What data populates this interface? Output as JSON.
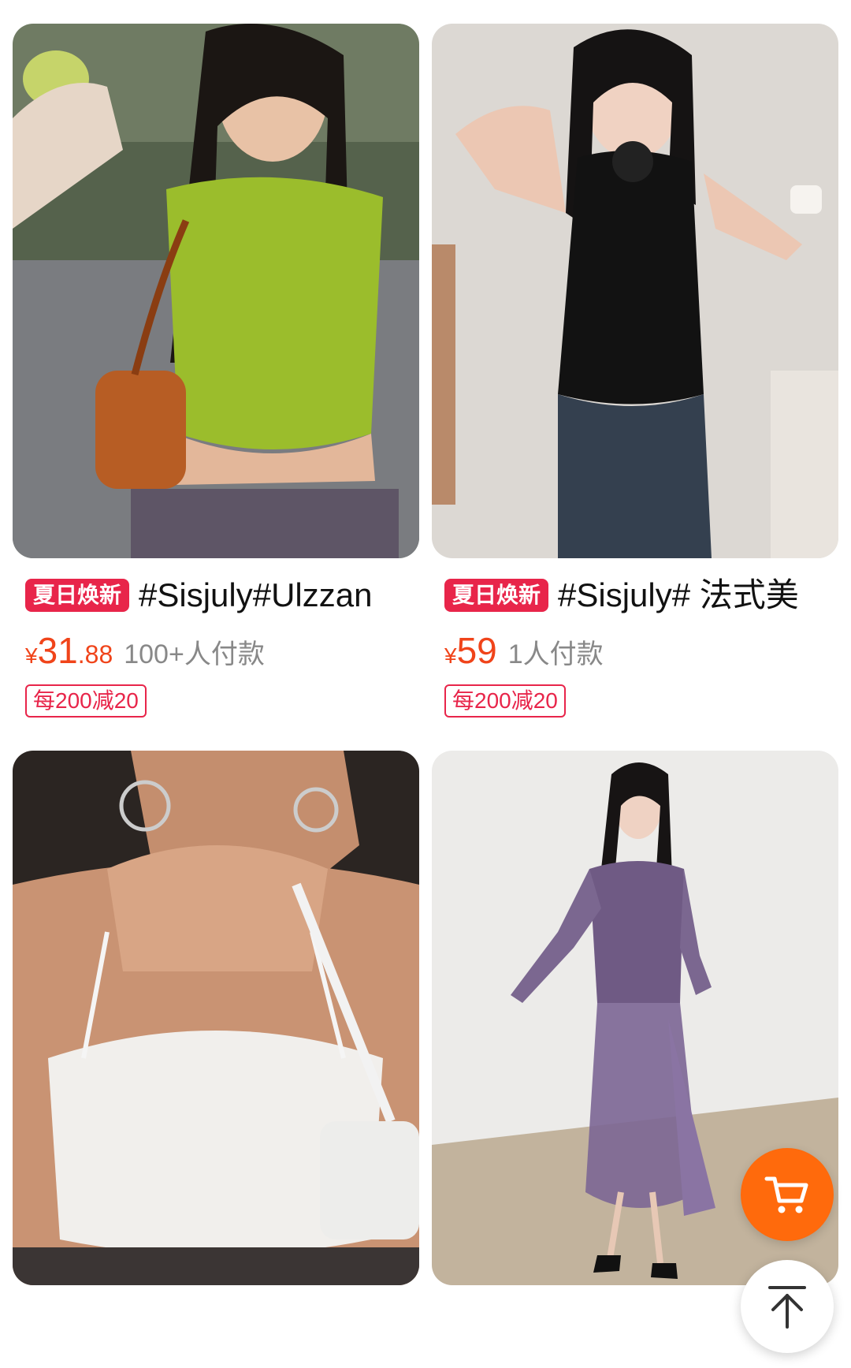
{
  "products": [
    {
      "tag": "夏日焕新",
      "title": "#Sisjuly#Ulzzan",
      "price_symbol": "¥",
      "price_int": "31",
      "price_dec": ".88",
      "sales": "100+人付款",
      "coupon": "每200减20",
      "image": "woman-green-crop-top-photo"
    },
    {
      "tag": "夏日焕新",
      "title": "#Sisjuly# 法式美",
      "price_symbol": "¥",
      "price_int": "59",
      "price_dec": "",
      "sales": "1人付款",
      "coupon": "每200减20",
      "image": "woman-black-halter-top-photo"
    },
    {
      "image": "woman-white-satin-camisole-photo"
    },
    {
      "image": "woman-purple-mesh-dress-photo"
    }
  ],
  "floating": {
    "cart_icon": "shopping-cart-icon",
    "top_icon": "arrow-up-to-top-icon"
  },
  "colors": {
    "tag_bg": "#e8254a",
    "price": "#f0441a",
    "cart_button": "#ff6a0c"
  }
}
